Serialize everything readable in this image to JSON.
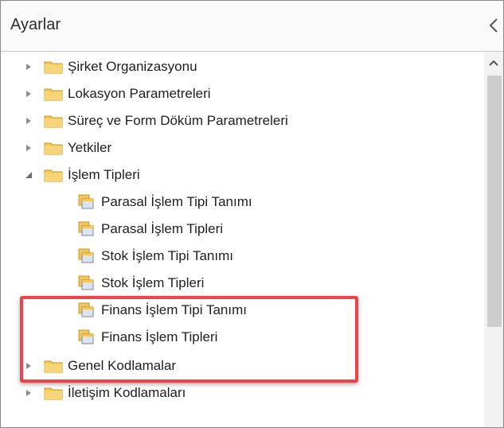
{
  "panel": {
    "title": "Ayarlar"
  },
  "tree": {
    "items": [
      {
        "label": "Şirket Organizasyonu",
        "type": "folder",
        "state": "collapsed"
      },
      {
        "label": "Lokasyon Parametreleri",
        "type": "folder",
        "state": "collapsed"
      },
      {
        "label": "Süreç ve Form Döküm Parametreleri",
        "type": "folder",
        "state": "collapsed"
      },
      {
        "label": "Yetkiler",
        "type": "folder",
        "state": "collapsed"
      },
      {
        "label": "İşlem Tipleri",
        "type": "folder",
        "state": "expanded"
      },
      {
        "label": "Parasal İşlem Tipi Tanımı",
        "type": "leaf"
      },
      {
        "label": "Parasal İşlem Tipleri",
        "type": "leaf"
      },
      {
        "label": "Stok İşlem Tipi Tanımı",
        "type": "leaf"
      },
      {
        "label": "Stok İşlem Tipleri",
        "type": "leaf"
      },
      {
        "label": "Finans İşlem Tipi Tanımı",
        "type": "leaf"
      },
      {
        "label": "Finans İşlem Tipleri",
        "type": "leaf"
      },
      {
        "label": "Genel Kodlamalar",
        "type": "folder",
        "state": "collapsed"
      },
      {
        "label": "İletişim Kodlamaları",
        "type": "folder",
        "state": "collapsed"
      }
    ]
  },
  "colors": {
    "folder": "#f3c65a",
    "highlight": "#e9454b",
    "scroll_thumb": "#cdcdcd"
  },
  "icons": {
    "expander_collapsed": "triangle-right-icon",
    "expander_expanded": "triangle-down-icon",
    "folder": "folder-icon",
    "leaf": "document-folder-icon"
  }
}
